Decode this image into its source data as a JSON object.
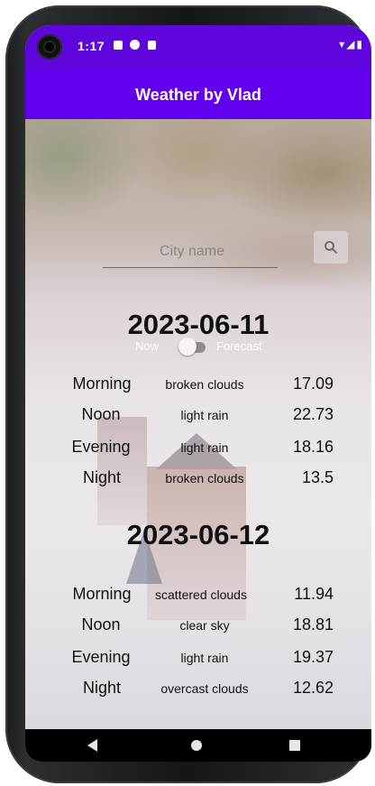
{
  "status_bar": {
    "time": "1:17",
    "right_icons": "▾◢▮"
  },
  "app_bar": {
    "title": "Weather by Vlad"
  },
  "search": {
    "placeholder": "City name",
    "value": ""
  },
  "mode_toggle": {
    "left_label": "Now",
    "right_label": "Forecast",
    "state": "off"
  },
  "days": [
    {
      "date": "2023-06-11",
      "rows": [
        {
          "period": "Morning",
          "description": "broken clouds",
          "temp": "17.09"
        },
        {
          "period": "Noon",
          "description": "light rain",
          "temp": "22.73"
        },
        {
          "period": "Evening",
          "description": "light rain",
          "temp": "18.16"
        },
        {
          "period": "Night",
          "description": "broken clouds",
          "temp": "13.5"
        }
      ]
    },
    {
      "date": "2023-06-12",
      "rows": [
        {
          "period": "Morning",
          "description": "scattered clouds",
          "temp": "11.94"
        },
        {
          "period": "Noon",
          "description": "clear sky",
          "temp": "18.81"
        },
        {
          "period": "Evening",
          "description": "light rain",
          "temp": "19.37"
        },
        {
          "period": "Night",
          "description": "overcast clouds",
          "temp": "12.62"
        }
      ]
    }
  ],
  "colors": {
    "status_bar": "#5f06dc",
    "app_bar": "#6200ee",
    "nav_bar": "#000000"
  },
  "icons": {
    "search": "search-icon",
    "back": "back-triangle-icon",
    "home": "home-circle-icon",
    "recents": "recents-square-icon"
  }
}
